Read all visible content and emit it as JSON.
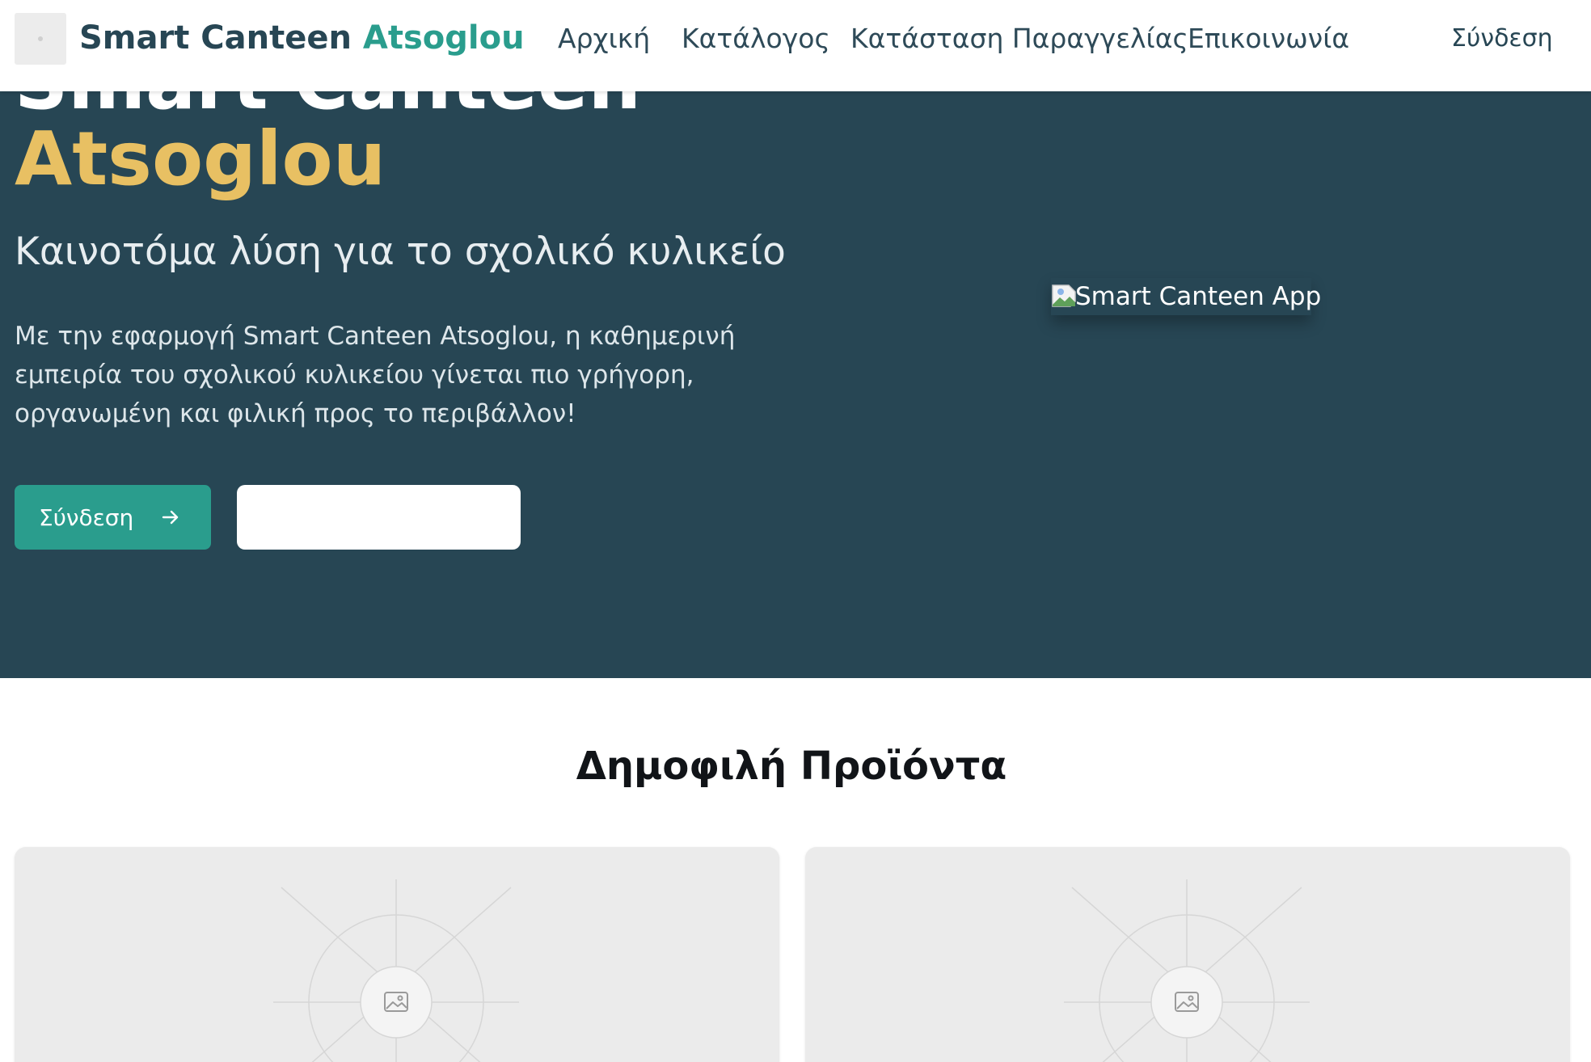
{
  "navbar": {
    "brand_part1": "Smart Canteen",
    "brand_part2": "Atsoglou",
    "links": [
      "Αρχική",
      "Κατάλογος",
      "Κατάσταση Παραγγελίας",
      "Επικοινωνία"
    ],
    "login_label": "Σύνδεση"
  },
  "hero": {
    "title_line1": "Smart Canteen",
    "title_line2": "Atsoglou",
    "subtitle": "Καινοτόμα λύση για το σχολικό κυλικείο",
    "description": "Με την εφαρμογή Smart Canteen Atsoglou, η καθημερινή εμπειρία του σχολικού κυλικείου γίνεται πιο γρήγορη, οργανωμένη και φιλική προς το περιβάλλον!",
    "login_button_label": "Σύνδεση",
    "login_button_icon": "arrow-right-icon",
    "image_alt": "Smart Canteen App"
  },
  "popular": {
    "title": "Δημοφιλή Προϊόντα",
    "cards_icon": "image-placeholder-icon"
  },
  "colors": {
    "hero_bg": "#274654",
    "accent_teal": "#2a9d8d",
    "accent_gold": "#e8c063",
    "card_bg": "#ebebeb"
  }
}
